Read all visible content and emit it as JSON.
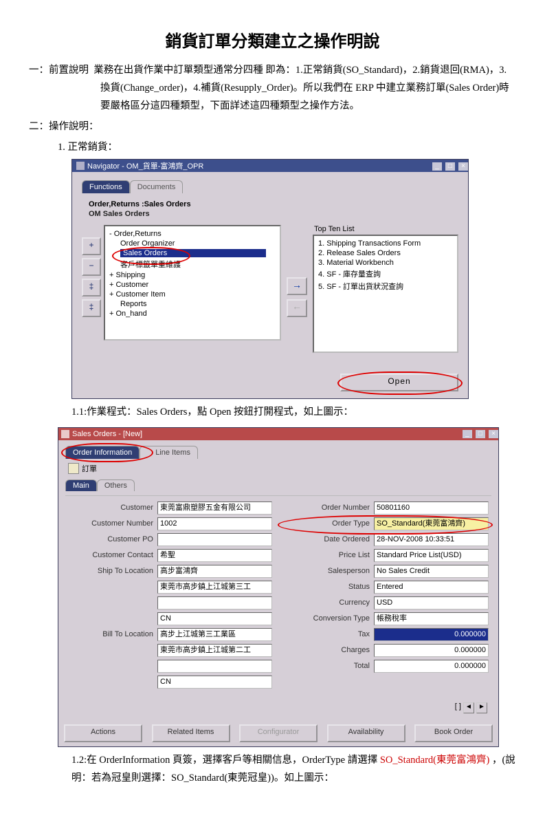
{
  "title": "銷貨訂單分類建立之操作明說",
  "para1_label": "一：前置說明",
  "para1_text": "業務在出貨作業中訂單類型通常分四種 即為：1.正常銷貨(SO_Standard)，2.銷貨退回(RMA)，3.換貨(Change_order)，4.補貨(Resupply_Order)。所以我們在 ERP 中建立業務訂單(Sales Order)時要嚴格區分這四種類型，下面詳述這四種類型之操作方法。",
  "para2_label": "二：操作說明：",
  "step1_label": "1. 正常銷貨：",
  "nav": {
    "wintitle": "Navigator - OM_貨單-富鴻齊_OPR",
    "tabs": {
      "active": "Functions",
      "other": "Documents"
    },
    "path": "Order,Returns :Sales Orders",
    "sub": "OM Sales Orders",
    "tree": [
      "- Order,Returns",
      "    Order Organizer",
      "    Sales Orders",
      "    客戶標籤單重維護",
      "+ Shipping",
      "+ Customer",
      "+ Customer Item",
      "    Reports",
      "+ On_hand"
    ],
    "ttl_label": "Top Ten List",
    "ttl": [
      "1. Shipping Transactions Form",
      "2. Release Sales Orders",
      "3. Material Workbench",
      "4. SF - 庫存量查詢",
      "5. SF - 訂單出貨狀況查詢"
    ],
    "open": "Open"
  },
  "caption11": "1.1:作業程式：Sales Orders，點  Open 按鈕打開程式，如上圖示：",
  "so": {
    "wintitle": "Sales Orders - [New]",
    "tabs": {
      "active": "Order Information",
      "other": "Line Items"
    },
    "subtitle": "訂單",
    "inner_tabs": {
      "active": "Main",
      "other": "Others"
    },
    "left_labels": [
      "Customer",
      "Customer Number",
      "Customer PO",
      "Customer Contact",
      "Ship To Location",
      "",
      "",
      "",
      "Bill To Location",
      "",
      "",
      ""
    ],
    "left_values": [
      "東莞富鼎塑膠五金有限公司",
      "1002",
      "",
      "希聖",
      "高步富鴻齊",
      "東莞市高步鎮上江城第三工",
      "",
      "CN",
      "高步上江城第三工業區",
      "東莞市高步鎮上江城第二工",
      "",
      "CN"
    ],
    "right_labels": [
      "Order Number",
      "Order Type",
      "Date Ordered",
      "Price List",
      "Salesperson",
      "Status",
      "Currency",
      "Conversion Type",
      "Tax",
      "Charges",
      "Total"
    ],
    "right_values": [
      "50801160",
      "SO_Standard(東莞富鴻齊)",
      "28-NOV-2008 10:33:51",
      "Standard Price List(USD)",
      "No Sales Credit",
      "Entered",
      "USD",
      "帳務稅率",
      "0.000000",
      "0.000000",
      "0.000000"
    ],
    "buttons": [
      "Actions",
      "Related Items",
      "Configurator",
      "Availability",
      "Book Order"
    ],
    "pager": "[ ]"
  },
  "caption12a": "1.2:在 OrderInformation 頁簽，選擇客戶等相關信息，OrderType 請選擇 ",
  "caption12b": "SO_Standard(東莞富鴻齊)",
  "caption12c": "，(說明：若為冠皇則選擇：SO_Standard(東莞冠皇))。如上圖示："
}
